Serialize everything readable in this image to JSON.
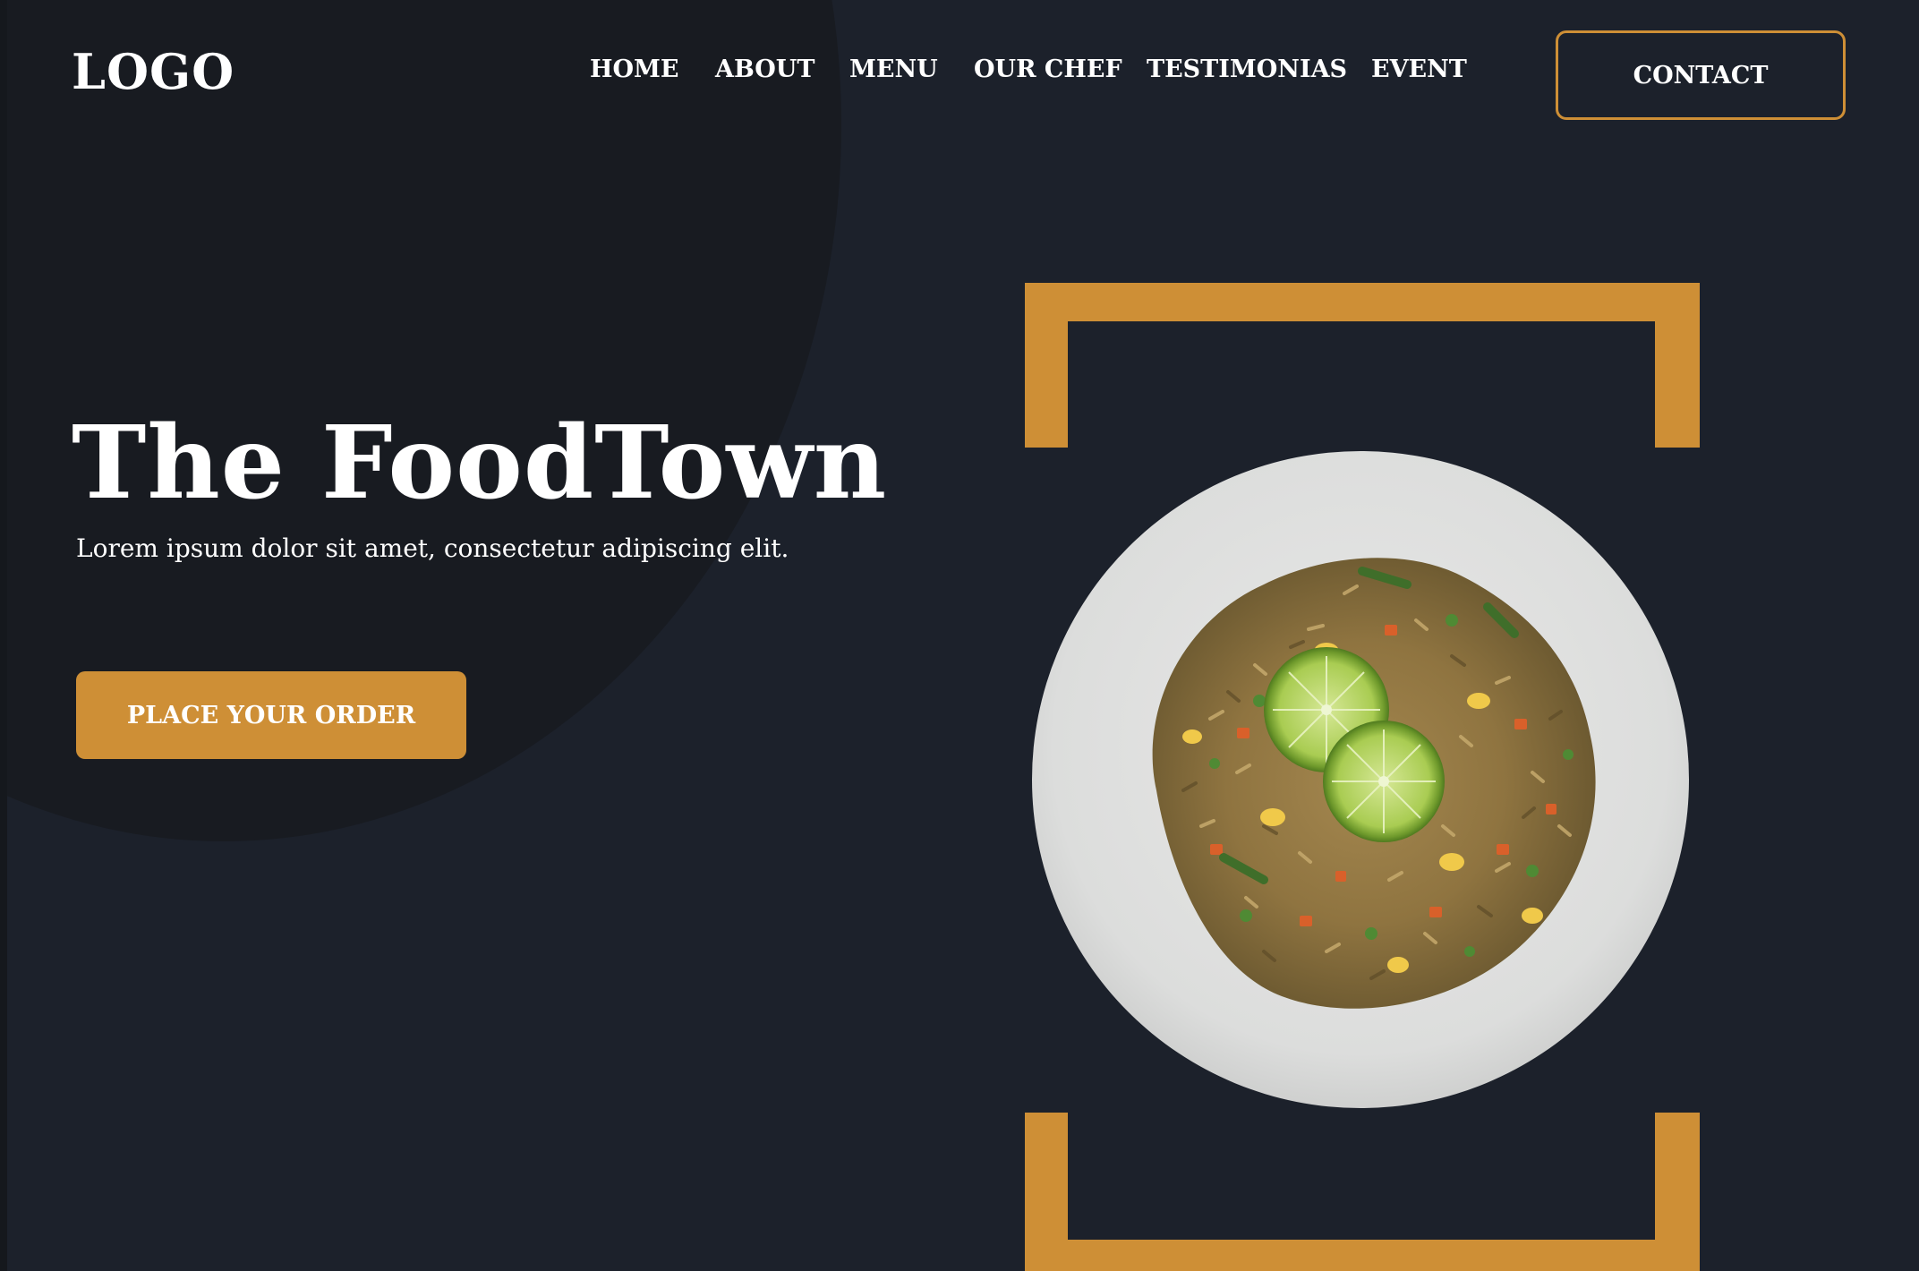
{
  "header": {
    "logo": "LOGO",
    "nav": [
      {
        "label": "HOME"
      },
      {
        "label": "ABOUT"
      },
      {
        "label": "MENU"
      },
      {
        "label": "OUR CHEF"
      },
      {
        "label": "TESTIMONIAS"
      },
      {
        "label": "EVENT"
      }
    ],
    "contact_label": "CONTACT"
  },
  "hero": {
    "title": "The FoodTown",
    "subtitle": "Lorem ipsum dolor sit amet, consectetur adipiscing elit.",
    "cta_label": "PLACE YOUR ORDER"
  },
  "image": {
    "subject": "plate-of-fried-rice-with-lime"
  },
  "colors": {
    "background": "#1c212b",
    "circle": "#181b21",
    "accent": "#ce8f36",
    "text": "#ffffff",
    "plate": "#e2e3e2"
  }
}
